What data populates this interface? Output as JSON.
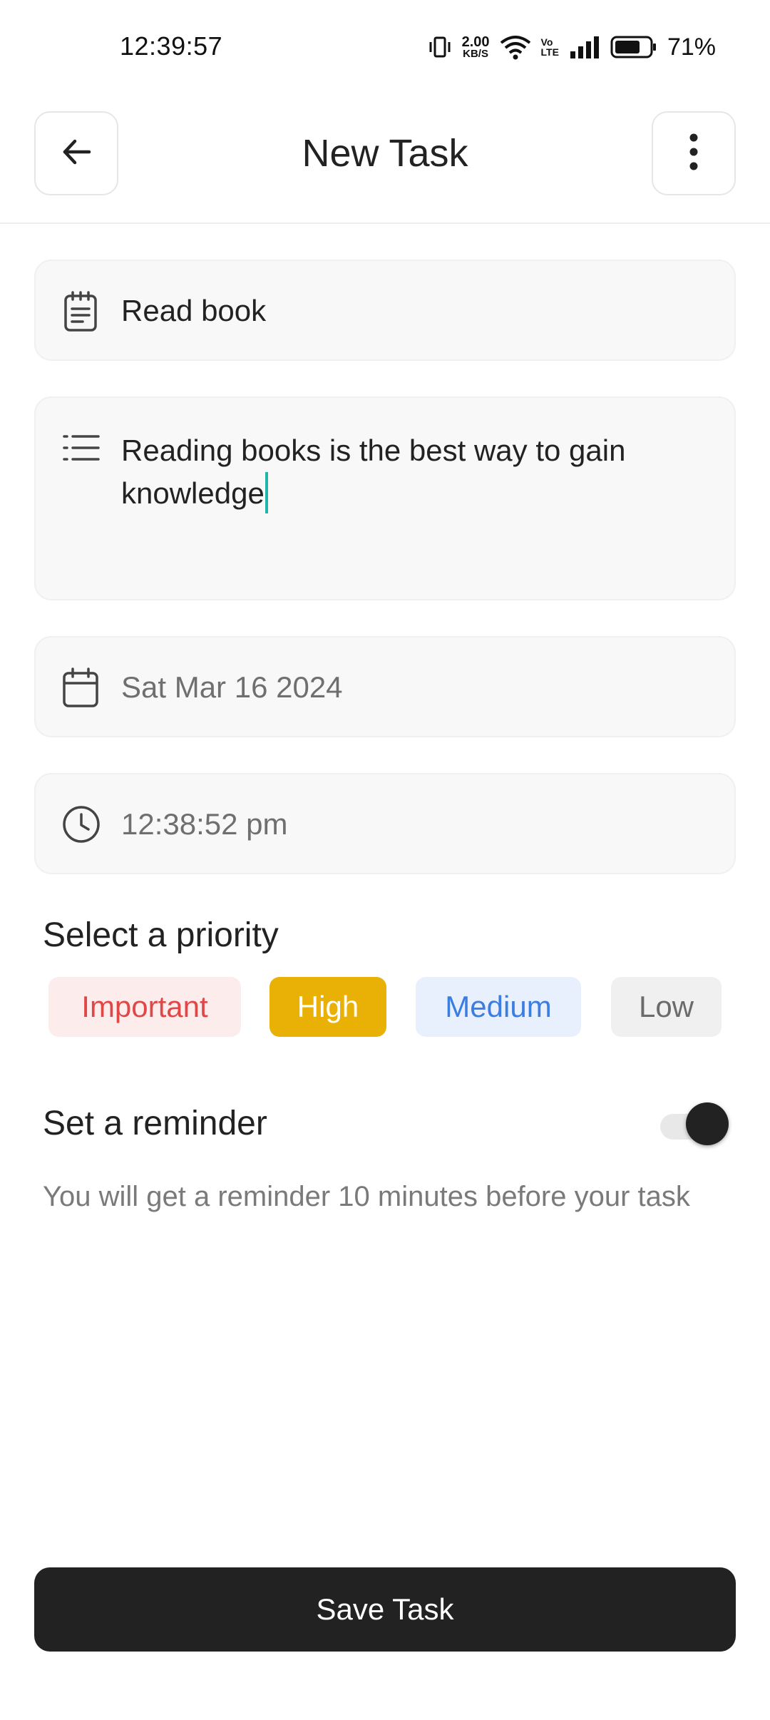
{
  "status_bar": {
    "time": "12:39:57",
    "net_speed": "2.00",
    "net_unit": "KB/S",
    "volte_top": "Vo",
    "volte_bottom": "LTE",
    "battery": "71%"
  },
  "header": {
    "title": "New Task",
    "back_icon": "arrow-left-icon",
    "menu_icon": "more-vertical-icon"
  },
  "form": {
    "title": {
      "value": "Read book",
      "icon": "notepad-icon"
    },
    "description": {
      "value": "Reading books is the best way to gain knowledge",
      "icon": "list-icon"
    },
    "date": {
      "value": "Sat Mar 16 2024",
      "icon": "calendar-icon"
    },
    "time": {
      "value": "12:38:52 pm",
      "icon": "clock-icon"
    }
  },
  "priority": {
    "heading": "Select a priority",
    "selected": "High",
    "options": [
      {
        "label": "Important",
        "color": "#e04848",
        "bg": "#fdecec"
      },
      {
        "label": "High",
        "color": "#ffffff",
        "bg": "#e9b006"
      },
      {
        "label": "Medium",
        "color": "#3b7de0",
        "bg": "#e9f0fd"
      },
      {
        "label": "Low",
        "color": "#6b6b6b",
        "bg": "#f0f0f0"
      }
    ]
  },
  "reminder": {
    "heading": "Set a reminder",
    "enabled": true,
    "description": "You will get a reminder 10 minutes before your task"
  },
  "actions": {
    "save_label": "Save Task"
  },
  "colors": {
    "accent_dark": "#222222",
    "caret": "#1fb5a9"
  }
}
